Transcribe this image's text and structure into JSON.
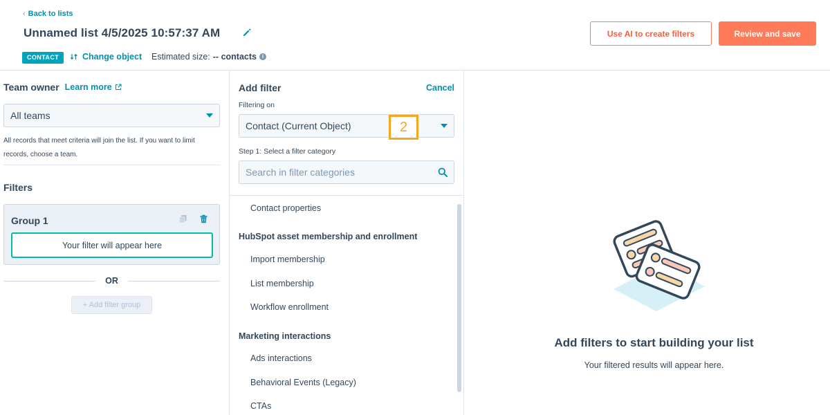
{
  "header": {
    "back_label": "Back to lists",
    "title": "Unnamed list 4/5/2025 10:57:37 AM",
    "object_badge": "CONTACT",
    "change_object_label": "Change object",
    "estimated_size_label": "Estimated size:",
    "estimated_size_value": "-- contacts",
    "ai_button_label": "Use AI to create filters",
    "review_button_label": "Review and save"
  },
  "left": {
    "team_owner_label": "Team owner",
    "learn_more_label": "Learn more",
    "team_select_value": "All teams",
    "team_help_text": "All records that meet criteria will join the list. If you want to limit records, choose a team.",
    "filters_heading": "Filters",
    "group_title": "Group 1",
    "filter_placeholder": "Your filter will appear here",
    "or_label": "OR",
    "add_group_label": "+ Add filter group"
  },
  "middle": {
    "title": "Add filter",
    "cancel_label": "Cancel",
    "filtering_on_label": "Filtering on",
    "object_select_value": "Contact (Current Object)",
    "step_badge": "2",
    "step1_label": "Step 1: Select a filter category",
    "search_placeholder": "Search in filter categories",
    "categories": {
      "contact_properties": "Contact properties",
      "hubspot_heading": "HubSpot asset membership and enrollment",
      "import_membership": "Import membership",
      "list_membership": "List membership",
      "workflow_enrollment": "Workflow enrollment",
      "marketing_heading": "Marketing interactions",
      "ads_interactions": "Ads interactions",
      "behavioral_events": "Behavioral Events (Legacy)",
      "ctas": "CTAs"
    }
  },
  "right": {
    "empty_title": "Add filters to start building your list",
    "empty_subtitle": "Your filtered results will appear here."
  },
  "colors": {
    "accent_link": "#0091ae",
    "primary_orange": "#ff7a59",
    "badge_teal": "#00a4bd",
    "highlight_orange": "#f5a623",
    "text_dark": "#33475b"
  }
}
